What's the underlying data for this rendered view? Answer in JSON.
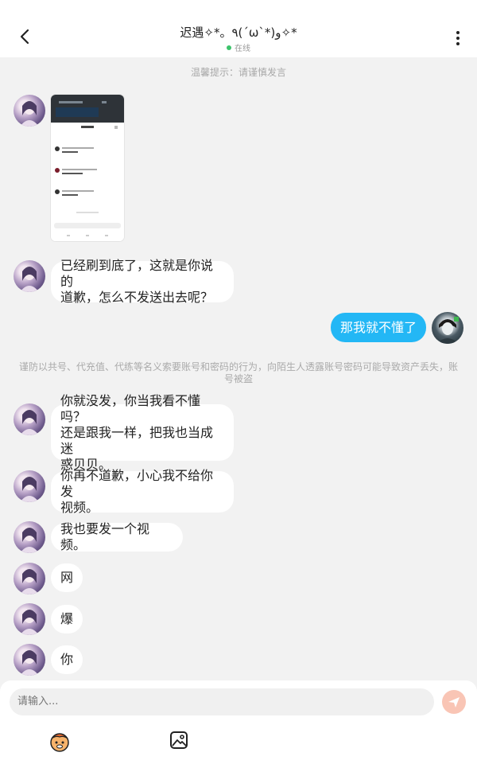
{
  "header": {
    "title": "迟遇✧*。٩(ˊωˋ*)و✧*",
    "status": "在线"
  },
  "chat": {
    "tip": "温馨提示：请谨慎发言",
    "warning": "谨防以共号、代充值、代练等名义索要账号和密码的行为，向陌生人透露账号密码可能导致资产丢失，账号被盗",
    "messages": [
      {
        "text": "已经刷到底了，这就是你说的\n道歉，怎么不发送出去呢？"
      },
      {
        "text": "那我就不懂了"
      },
      {
        "text": "你就没发，你当我看不懂吗？\n还是跟我一样，把我也当成迷\n惑贝贝。"
      },
      {
        "text": "你再不道歉，小心我不给你发\n视频。"
      },
      {
        "text": "我也要发一个视频。"
      },
      {
        "text": "网"
      },
      {
        "text": "爆"
      },
      {
        "text": "你"
      }
    ]
  },
  "composer": {
    "placeholder": "请输入..."
  },
  "icons": {
    "back": "chevron-left-icon",
    "more": "more-vertical-icon",
    "send": "send-icon",
    "emoji": "emoji-sticker-icon",
    "image": "image-picker-icon"
  },
  "colors": {
    "accent": "#23b7f5",
    "online": "#3cc36b",
    "send_button": "#f9c5b5"
  }
}
